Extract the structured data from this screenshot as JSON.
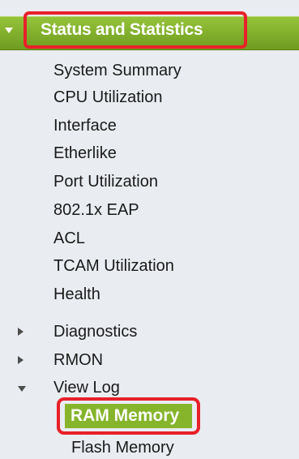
{
  "section": {
    "title": "Status and Statistics"
  },
  "menu": {
    "items": [
      {
        "label": "System Summary"
      },
      {
        "label": "CPU Utilization"
      },
      {
        "label": "Interface"
      },
      {
        "label": "Etherlike"
      },
      {
        "label": "Port Utilization"
      },
      {
        "label": "802.1x EAP"
      },
      {
        "label": "ACL"
      },
      {
        "label": "TCAM Utilization"
      },
      {
        "label": "Health"
      },
      {
        "label": "Diagnostics",
        "state": "collapsed"
      },
      {
        "label": "RMON",
        "state": "collapsed"
      },
      {
        "label": "View Log",
        "state": "expanded"
      }
    ],
    "view_log_children": [
      {
        "label": "RAM Memory",
        "selected": true
      },
      {
        "label": "Flash Memory"
      }
    ]
  },
  "colors": {
    "header_green": "#86b52c",
    "highlight_red": "#e8202a",
    "background": "#e9ecf0"
  },
  "icons": {
    "section_expander": "caret-down-icon",
    "collapsed_expander": "caret-right-icon",
    "expanded_expander": "caret-down-icon"
  }
}
